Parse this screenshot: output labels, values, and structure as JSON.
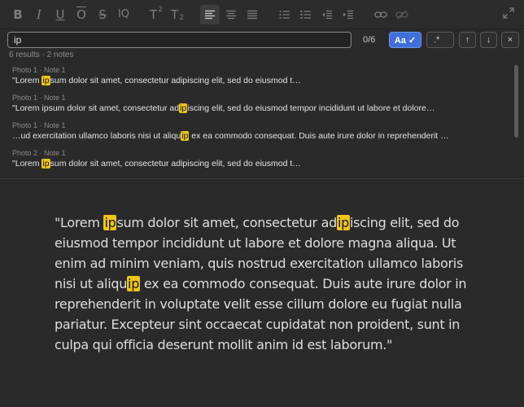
{
  "toolbar": {
    "buttons": [
      {
        "name": "bold-button",
        "label": "B"
      },
      {
        "name": "italic-button",
        "label": "I"
      },
      {
        "name": "underline-button",
        "label": "U"
      },
      {
        "name": "overline-button",
        "label": "O"
      },
      {
        "name": "strikethrough-button",
        "label": "S"
      },
      {
        "name": "clear-format-button",
        "label": "IQ"
      }
    ],
    "superscript_label": "T",
    "superscript_mark": "2",
    "subscript_label": "T",
    "subscript_mark": "2",
    "active_button": "align-left"
  },
  "find": {
    "query": "ip",
    "count": "0/6",
    "case_label": "Aa ✓",
    "case_active": true,
    "regex_label": ".*",
    "up_label": "↑",
    "down_label": "↓",
    "close_label": "×",
    "accent_color": "#3f6fd9",
    "highlight_color": "#f0c419"
  },
  "summary": "6 results · 2 notes",
  "results": [
    {
      "meta": "Photo 1 · Note 1",
      "pre": "\"Lorem ",
      "match": "ip",
      "post": "sum dolor sit amet, consectetur adipiscing elit, sed do eiusmod t…"
    },
    {
      "meta": "Photo 1 · Note 1",
      "pre": "\"Lorem ipsum dolor sit amet, consectetur ad",
      "match": "ip",
      "post": "iscing elit, sed do eiusmod tempor incididunt ut labore et dolore…"
    },
    {
      "meta": "Photo 1 · Note 1",
      "pre": "…ud exercitation ullamco laboris nisi ut aliqu",
      "match": "ip",
      "post": " ex ea commodo consequat. Duis aute irure dolor in reprehenderit …"
    },
    {
      "meta": "Photo 2 · Note 1",
      "pre": "\"Lorem ",
      "match": "ip",
      "post": "sum dolor sit amet, consectetur adipiscing elit, sed do eiusmod t…"
    }
  ],
  "note": {
    "s1": "\"Lorem ",
    "m1": "ip",
    "s2": "sum dolor sit amet, consectetur ad",
    "m2": "ip",
    "s3": "iscing elit, sed do eiusmod tempor incididunt ut labore et dolore magna aliqua. Ut enim ad minim veniam, quis nostrud exercitation ullamco laboris nisi ut aliqu",
    "m3": "ip",
    "s4": " ex ea commodo consequat. Duis aute irure dolor in reprehenderit in voluptate velit esse cillum dolore eu fugiat nulla pariatur. Excepteur sint occaecat cupidatat non proident, sunt in culpa qui officia deserunt mollit anim id est laborum.\""
  }
}
